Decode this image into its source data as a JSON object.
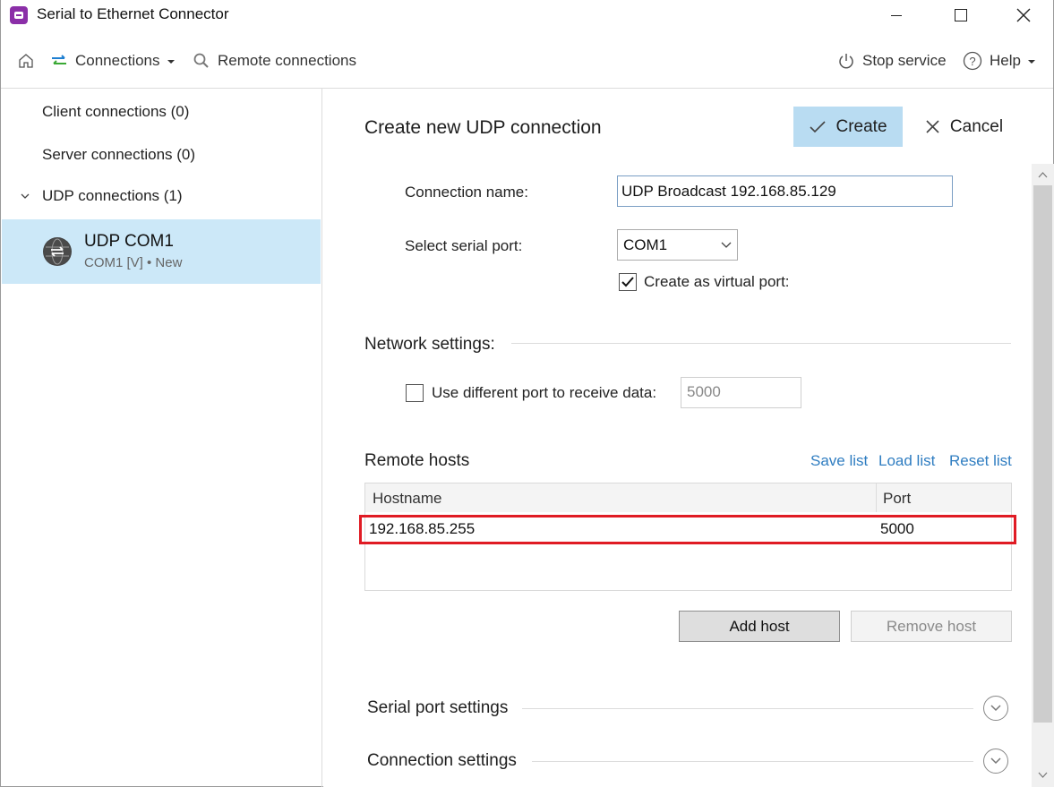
{
  "window": {
    "title": "Serial to Ethernet Connector"
  },
  "toolbar": {
    "connections_label": "Connections",
    "remote_label": "Remote connections",
    "stop_service_label": "Stop service",
    "help_label": "Help"
  },
  "sidebar": {
    "client": "Client connections (0)",
    "server": "Server connections (0)",
    "udp_group": "UDP connections (1)",
    "selected_item": {
      "name": "UDP COM1",
      "subtitle": "COM1 [V] • New"
    }
  },
  "panel": {
    "title": "Create new UDP connection",
    "create_label": "Create",
    "cancel_label": "Cancel",
    "connection_name_label": "Connection name:",
    "connection_name_value": "UDP Broadcast 192.168.85.129",
    "serial_port_label": "Select serial port:",
    "serial_port_value": "COM1",
    "virtual_port_label": "Create as virtual port:",
    "virtual_port_checked": true
  },
  "network": {
    "title": "Network settings:",
    "diff_port_label": "Use different port to receive data:",
    "diff_port_checked": false,
    "diff_port_value": "5000"
  },
  "remote_hosts": {
    "title": "Remote hosts",
    "save_list": "Save list",
    "load_list": "Load list",
    "reset_list": "Reset list",
    "columns": [
      "Hostname",
      "Port"
    ],
    "rows": [
      {
        "hostname": "192.168.85.255",
        "port": "5000"
      }
    ],
    "add_host": "Add host",
    "remove_host": "Remove host"
  },
  "sections": {
    "serial_port_settings": "Serial port settings",
    "connection_settings": "Connection settings"
  },
  "colors": {
    "accent_button": "#b9dcf2",
    "selected_bg": "#cce8f8",
    "link": "#2f7dc1",
    "highlight": "#e01b24",
    "app_icon": "#8b2fa8"
  }
}
